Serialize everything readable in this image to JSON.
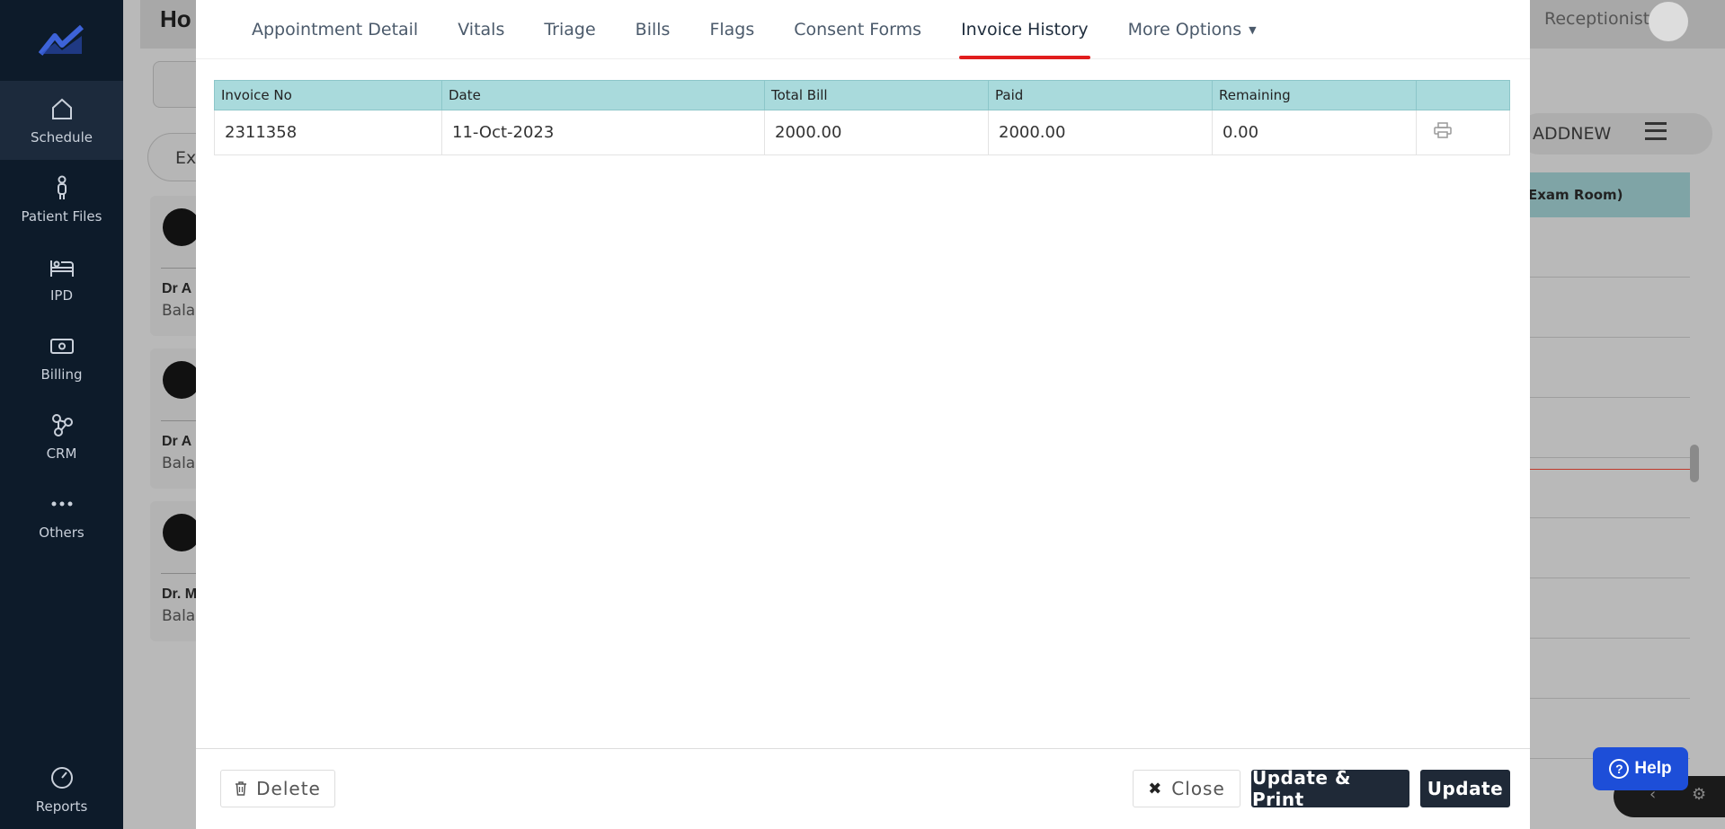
{
  "background": {
    "page_title": "Ho",
    "user_role": "Receptionist",
    "filter_text": "Ex",
    "addnew_label": "ADDNEW",
    "room_header": "Exam Room)",
    "cards": [
      {
        "name": "Dr A",
        "sub": "Bala"
      },
      {
        "name": "Dr A",
        "sub": "Bala"
      },
      {
        "name": "Dr. M",
        "sub": "Bala"
      }
    ]
  },
  "sidebar": {
    "items": [
      {
        "label": "Schedule",
        "icon": "home-icon"
      },
      {
        "label": "Patient Files",
        "icon": "person-icon"
      },
      {
        "label": "IPD",
        "icon": "bed-icon"
      },
      {
        "label": "Billing",
        "icon": "cash-icon"
      },
      {
        "label": "CRM",
        "icon": "crm-icon"
      },
      {
        "label": "Others",
        "icon": "more-icon"
      }
    ],
    "bottom": {
      "label": "Reports",
      "icon": "gauge-icon"
    }
  },
  "modal": {
    "tabs": [
      {
        "label": "Appointment Detail"
      },
      {
        "label": "Vitals"
      },
      {
        "label": "Triage"
      },
      {
        "label": "Bills"
      },
      {
        "label": "Flags"
      },
      {
        "label": "Consent Forms"
      },
      {
        "label": "Invoice History",
        "active": true
      },
      {
        "label": "More Options",
        "dropdown": true
      }
    ],
    "table": {
      "columns": [
        "Invoice No",
        "Date",
        "Total Bill",
        "Paid",
        "Remaining",
        ""
      ],
      "rows": [
        [
          "2311358",
          "11-Oct-2023",
          "2000.00",
          "2000.00",
          "0.00"
        ]
      ]
    },
    "footer": {
      "delete_label": "Delete",
      "close_label": "Close",
      "update_print_label": "Update & Print",
      "update_label": "Update"
    }
  },
  "help": {
    "label": "Help"
  },
  "colors": {
    "sidebar_bg": "#0d1b2a",
    "table_header": "#a9dadc",
    "active_tab_underline": "#e11d1d",
    "primary_button": "#1f2937",
    "help_button": "#1d4ed8"
  }
}
